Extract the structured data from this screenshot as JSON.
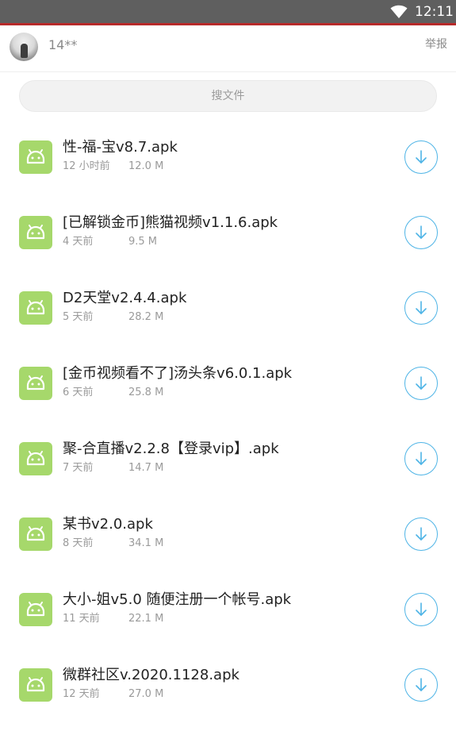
{
  "status_bar": {
    "time": "12:11",
    "icons": [
      "wifi-icon"
    ]
  },
  "header": {
    "username": "14**",
    "report_label": "举报"
  },
  "search": {
    "placeholder": "搜文件"
  },
  "colors": {
    "status_bar_bg": "#5f5f5f",
    "accent_line": "#b72a2a",
    "apk_icon": "#a6d86b",
    "download_icon": "#4eb4e6"
  },
  "files": [
    {
      "name": "性-福-宝v8.7.apk",
      "time": "12 小时前",
      "size": "12.0 M",
      "icon": "android-apk-icon"
    },
    {
      "name": "[已解锁金币]熊猫视频v1.1.6.apk",
      "time": "4 天前",
      "size": "9.5 M",
      "icon": "android-apk-icon"
    },
    {
      "name": "D2天堂v2.4.4.apk",
      "time": "5 天前",
      "size": "28.2 M",
      "icon": "android-apk-icon"
    },
    {
      "name": "[金币视频看不了]汤头条v6.0.1.apk",
      "time": "6 天前",
      "size": "25.8 M",
      "icon": "android-apk-icon"
    },
    {
      "name": "聚-合直播v2.2.8【登录vip】.apk",
      "time": "7 天前",
      "size": "14.7 M",
      "icon": "android-apk-icon"
    },
    {
      "name": "某书v2.0.apk",
      "time": "8 天前",
      "size": "34.1 M",
      "icon": "android-apk-icon"
    },
    {
      "name": "大小-姐v5.0 随便注册一个帐号.apk",
      "time": "11 天前",
      "size": "22.1 M",
      "icon": "android-apk-icon"
    },
    {
      "name": "微群社区v.2020.1128.apk",
      "time": "12 天前",
      "size": "27.0 M",
      "icon": "android-apk-icon"
    }
  ]
}
